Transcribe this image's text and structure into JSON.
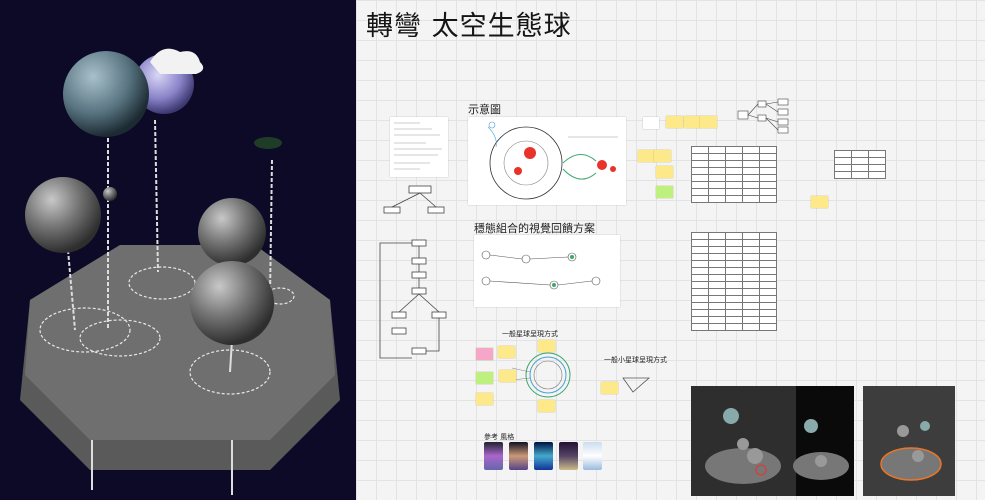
{
  "board": {
    "title": "轉彎 太空生態球",
    "section_labels": {
      "diagram": "示意圖",
      "feedback": "穩態組合的視覺回饋方案",
      "general_star": "一般星球呈現方式",
      "general_small_star": "一般小星球呈現方式",
      "references": "參考 風格"
    }
  },
  "colors": {
    "viewport_bg": "#0c0a26",
    "board_bg": "#f4f4f4",
    "sticky_yellow": "#fde88a",
    "sticky_pink": "#f6a6c8",
    "sticky_green": "#bdf07e",
    "accent_red": "#e8322a",
    "accent_green": "#3ea86b"
  },
  "icons": {
    "viewport": "3d-scene",
    "board": "whiteboard-canvas"
  }
}
